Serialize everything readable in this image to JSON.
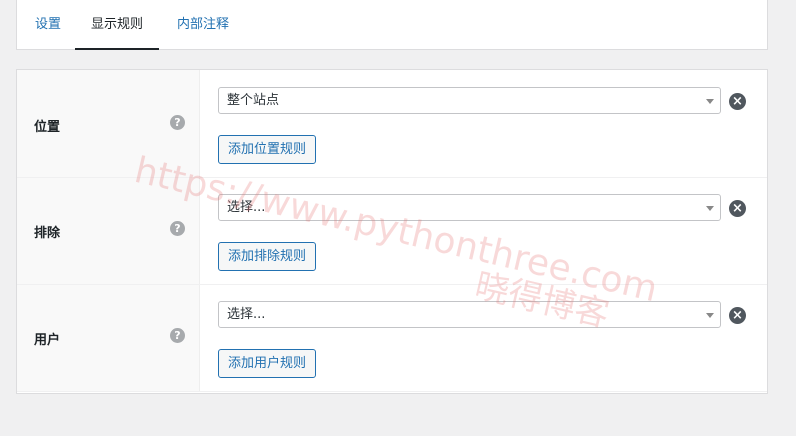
{
  "tabs": [
    {
      "label": "设置"
    },
    {
      "label": "显示规则",
      "active": true
    },
    {
      "label": "内部注释"
    }
  ],
  "rules": [
    {
      "label": "位置",
      "select_value": "整个站点",
      "add_button": "添加位置规则"
    },
    {
      "label": "排除",
      "select_value": "选择...",
      "add_button": "添加排除规则"
    },
    {
      "label": "用户",
      "select_value": "选择...",
      "add_button": "添加用户规则"
    }
  ],
  "help_glyph": "?",
  "remove_glyph": "×",
  "watermark": {
    "url": "https://www.pythonthree.com",
    "brand": "晓得博客"
  },
  "colors": {
    "accent": "#2271b1",
    "text": "#1d2327",
    "background": "#f0f0f1"
  }
}
